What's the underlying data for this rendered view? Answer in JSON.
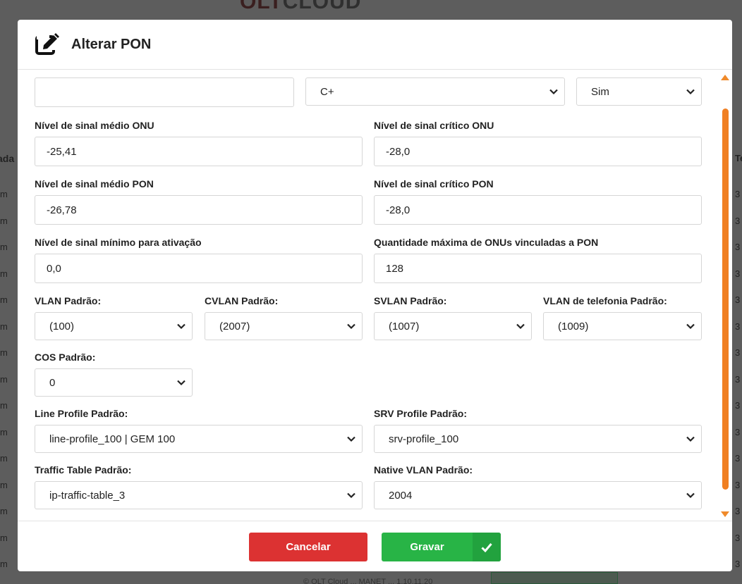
{
  "background": {
    "logo_part1": "OLT",
    "logo_part2": "CLOUD",
    "left_header": "ada",
    "left_cells": [
      "m",
      "m",
      "m",
      "m",
      "m",
      "m",
      "m",
      "m",
      "m",
      "m",
      "m",
      "m",
      "m",
      "m",
      "m"
    ],
    "right_header": "Te",
    "right_cells": [
      "3",
      "3",
      "3",
      "3",
      "3",
      "3",
      "3",
      "3",
      "3",
      "3",
      "3",
      "3",
      "3",
      "3",
      "3"
    ],
    "footer_text": "© OLT Cloud ... MANET ... 1.10.11.20"
  },
  "modal": {
    "title": "Alterar PON",
    "icon": "edit-icon",
    "top_row": {
      "text_value": "",
      "select_value": "C+",
      "select2_value": "Sim"
    },
    "fields": {
      "sinal_medio_onu": {
        "label": "Nível de sinal médio ONU",
        "value": "-25,41"
      },
      "sinal_critico_onu": {
        "label": "Nível de sinal crítico ONU",
        "value": "-28,0"
      },
      "sinal_medio_pon": {
        "label": "Nível de sinal médio PON",
        "value": "-26,78"
      },
      "sinal_critico_pon": {
        "label": "Nível de sinal crítico PON",
        "value": "-28,0"
      },
      "sinal_minimo": {
        "label": "Nível de sinal mínimo para ativação",
        "value": "0,0"
      },
      "qtd_max_onus": {
        "label": "Quantidade máxima de ONUs vinculadas a PON",
        "value": "128"
      },
      "vlan": {
        "label": "VLAN Padrão:",
        "value": "(100)"
      },
      "cvlan": {
        "label": "CVLAN Padrão:",
        "value": "(2007)"
      },
      "svlan": {
        "label": "SVLAN Padrão:",
        "value": "(1007)"
      },
      "vlan_tel": {
        "label": "VLAN de telefonia Padrão:",
        "value": "(1009)"
      },
      "cos": {
        "label": "COS Padrão:",
        "value": "0"
      },
      "line_profile": {
        "label": "Line Profile Padrão:",
        "value": "line-profile_100 | GEM 100"
      },
      "srv_profile": {
        "label": "SRV Profile Padrão:",
        "value": "srv-profile_100"
      },
      "traffic_table": {
        "label": "Traffic Table Padrão:",
        "value": "ip-traffic-table_3"
      },
      "native_vlan": {
        "label": "Native VLAN Padrão:",
        "value": "2004"
      }
    },
    "buttons": {
      "cancel": "Cancelar",
      "save": "Gravar"
    }
  },
  "colors": {
    "accent_scroll": "#f07f22",
    "cancel": "#dc3232",
    "save": "#28b446"
  }
}
